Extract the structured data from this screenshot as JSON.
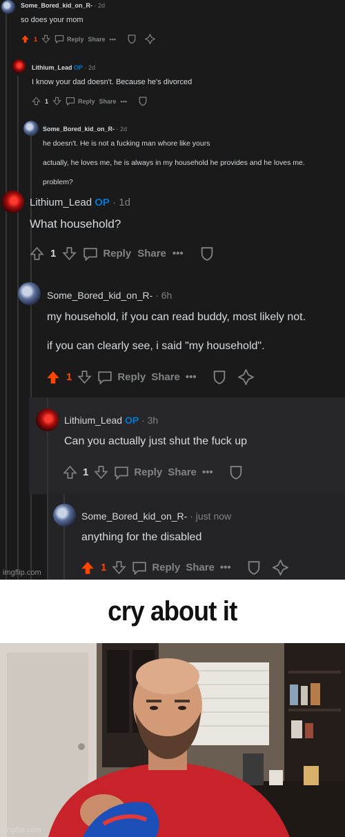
{
  "accent": "#ff4500",
  "op_color": "#0079d3",
  "comments": [
    {
      "user": "Some_Bored_kid_on_R-",
      "op": "",
      "age": "· 2d",
      "lines": [
        "so does your mom"
      ],
      "votes": "1",
      "upvoted": true,
      "reply": "Reply",
      "share": "Share",
      "more": "•••"
    },
    {
      "user": "Lithium_Lead",
      "op": "OP",
      "age": "· 2d",
      "lines": [
        "I know your dad doesn't. Because he's divorced"
      ],
      "votes": "1",
      "upvoted": false,
      "reply": "Reply",
      "share": "Share",
      "more": "•••"
    },
    {
      "user": "Some_Bored_kid_on_R-",
      "op": "",
      "age": "· 2d",
      "lines": [
        "he doesn't. He is not a fucking man whore like yours",
        "actually, he loves me, he is always in my household he provides and he loves me.",
        "problem?"
      ]
    },
    {
      "user": "Lithium_Lead",
      "op": "OP",
      "age": "· 1d",
      "lines": [
        "What household?"
      ],
      "votes": "1",
      "upvoted": false,
      "reply": "Reply",
      "share": "Share",
      "more": "•••"
    },
    {
      "user": "Some_Bored_kid_on_R-",
      "op": "",
      "age": "· 6h",
      "lines": [
        "my household, if you can read buddy, most likely not.",
        "if you can clearly see, i said \"my household\"."
      ],
      "votes": "1",
      "upvoted": true,
      "reply": "Reply",
      "share": "Share",
      "more": "•••"
    },
    {
      "user": "Lithium_Lead",
      "op": "OP",
      "age": "· 3h",
      "lines": [
        "Can you actually just shut the fuck up"
      ],
      "votes": "1",
      "upvoted": false,
      "reply": "Reply",
      "share": "Share",
      "more": "•••"
    },
    {
      "user": "Some_Bored_kid_on_R-",
      "op": "",
      "age": "· just now",
      "lines": [
        "anything for the disabled"
      ],
      "votes": "1",
      "upvoted": true,
      "reply": "Reply",
      "share": "Share",
      "more": "•••"
    }
  ],
  "watermark": "imgflip.com",
  "caption": "cry about it"
}
